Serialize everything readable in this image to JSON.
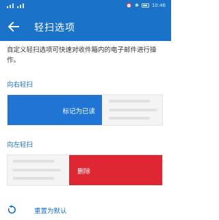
{
  "status_bar": {
    "time": "10:46",
    "carrier_indicator": "∙∙∙"
  },
  "app_bar": {
    "title": "轻扫选项",
    "back_icon": "arrow-left-icon"
  },
  "description": "自定义轻扫选项可快速对收件箱内的电子邮件进行操作。",
  "swipe_right": {
    "section_label": "向右轻扫",
    "action_label": "标记为已读",
    "action_color": "#1f74d4"
  },
  "swipe_left": {
    "section_label": "向左轻扫",
    "action_label": "删除",
    "action_color": "#df2633"
  },
  "reset": {
    "label": "重置为默认",
    "icon": "reset-icon"
  },
  "colors": {
    "accent": "#1a73c9",
    "link": "#1a6fc4"
  }
}
